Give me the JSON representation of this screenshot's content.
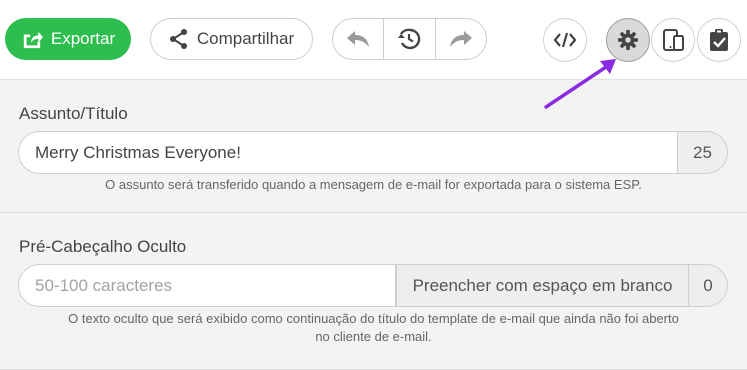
{
  "toolbar": {
    "export_label": "Exportar",
    "share_label": "Compartilhar",
    "icons": {
      "export": "export-icon",
      "share": "share-icon",
      "undo": "undo-icon",
      "history": "history-icon",
      "redo": "redo-icon",
      "code": "code-icon",
      "settings": "gear-icon",
      "device": "device-preview-icon",
      "clipboard": "clipboard-check-icon"
    }
  },
  "colors": {
    "export_bg": "#2dbe4e",
    "annotation_arrow": "#8a2be2"
  },
  "subject": {
    "label": "Assunto/Título",
    "value": "Merry Christmas Everyone!",
    "char_count": "25",
    "help": "O assunto será transferido quando a mensagem de e-mail for exportada para o sistema ESP."
  },
  "preheader": {
    "label": "Pré-Cabeçalho Oculto",
    "placeholder": "50-100 caracteres",
    "fill_button": "Preencher com espaço em branco",
    "char_count": "0",
    "help_line1": "O texto oculto que será exibido como continuação do título do template de e-mail que ainda não foi aberto",
    "help_line2": "no cliente de e-mail."
  }
}
